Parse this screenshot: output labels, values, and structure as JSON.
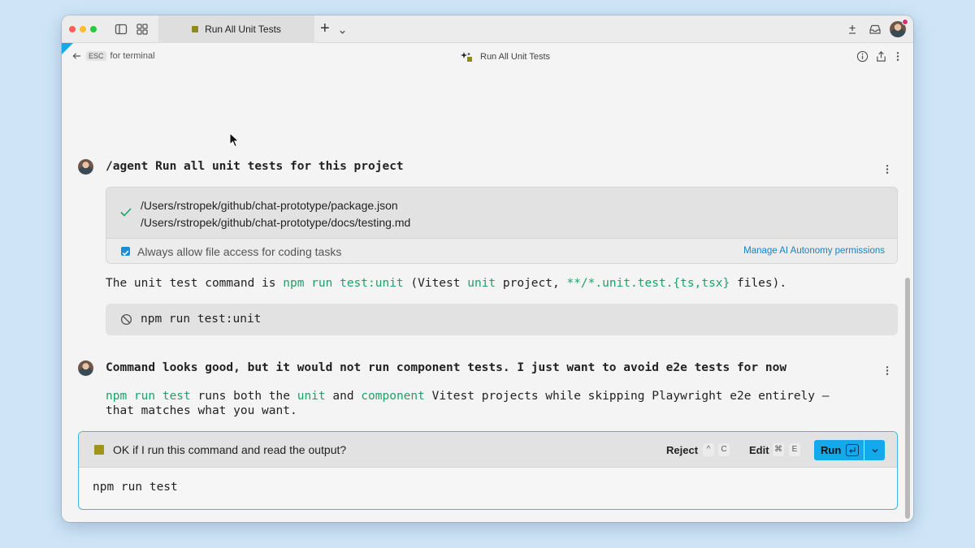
{
  "tabbar": {
    "tab_title": "Run All Unit Tests",
    "plus": "+"
  },
  "subheader": {
    "esc_key": "ESC",
    "back_label": "for terminal",
    "title": "Run All Unit Tests"
  },
  "conversation": {
    "user_prompt_1": "/agent Run all unit tests for this project",
    "file_access": {
      "paths": [
        "/Users/rstropek/github/chat-prototype/package.json",
        "/Users/rstropek/github/chat-prototype/docs/testing.md"
      ],
      "checkbox_label": "Always allow file access for coding tasks",
      "checkbox_checked": true,
      "manage_link": "Manage AI Autonomy permissions"
    },
    "response_1": {
      "t1": "The unit test command is ",
      "t2": "npm run test:unit",
      "t3": " (Vitest ",
      "t4": "unit",
      "t5": " project, ",
      "t6": "**/*.unit.test.{ts,tsx}",
      "t7": " files)."
    },
    "rejected_command": "npm run test:unit",
    "user_prompt_2": "Command looks good, but it would not run component tests. I just want to avoid e2e tests for now",
    "response_2": {
      "t1": "npm run test",
      "t2": " runs both the ",
      "t3": "unit",
      "t4": " and ",
      "t5": "component",
      "t6": " Vitest projects while skipping Playwright e2e entirely —",
      "line2": "that matches what you want."
    },
    "approval": {
      "question": "OK if I run this command and read the output?",
      "reject_label": "Reject",
      "reject_keys": [
        "^",
        "C"
      ],
      "edit_label": "Edit",
      "edit_keys": [
        "⌘",
        "E"
      ],
      "run_label": "Run",
      "command": "npm run test"
    }
  },
  "colors": {
    "accent": "#14a8ec",
    "code_green": "#1fa06a",
    "link": "#1a82c4",
    "background": "#cfe5f7"
  }
}
